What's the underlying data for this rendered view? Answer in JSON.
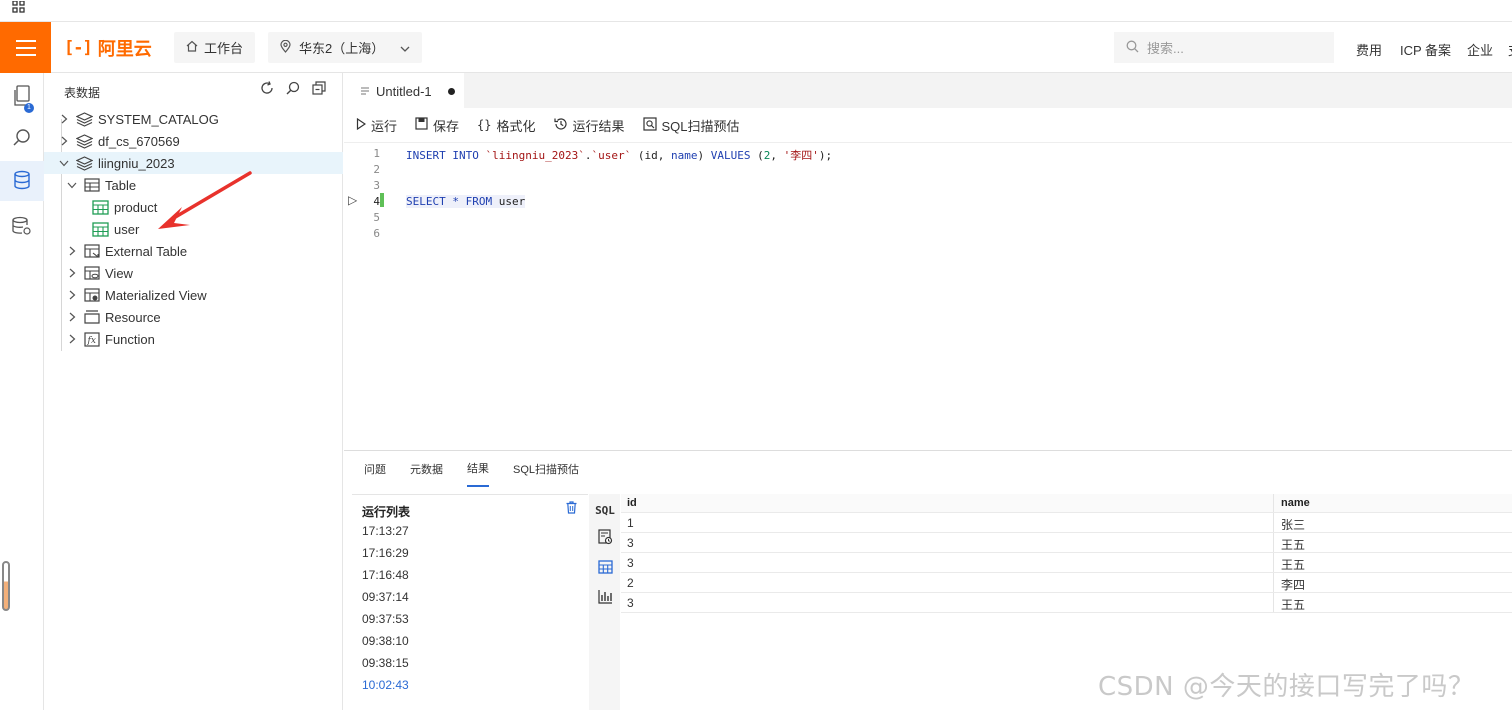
{
  "header": {
    "logo_text": "阿里云",
    "workbench_label": "工作台",
    "region_label": "华东2（上海）",
    "search_placeholder": "搜索...",
    "links": [
      "费用",
      "ICP 备案",
      "企业",
      "支"
    ]
  },
  "rail": {
    "badge": "1"
  },
  "tree": {
    "title": "表数据",
    "nodes": [
      {
        "label": "SYSTEM_CATALOG"
      },
      {
        "label": "df_cs_670569"
      },
      {
        "label": "liingniu_2023"
      },
      {
        "label": "Table"
      },
      {
        "label": "product"
      },
      {
        "label": "user"
      },
      {
        "label": "External Table"
      },
      {
        "label": "View"
      },
      {
        "label": "Materialized View"
      },
      {
        "label": "Resource"
      },
      {
        "label": "Function"
      }
    ]
  },
  "editor": {
    "tab_label": "Untitled-1",
    "toolbar": [
      "运行",
      "保存",
      "格式化",
      "运行结果",
      "SQL扫描预估"
    ],
    "line_numbers": [
      "1",
      "2",
      "3",
      "4",
      "5",
      "6"
    ],
    "line1": {
      "insert": "INSERT INTO",
      "db": "`liingniu_2023`",
      "dot": ".",
      "table": "`user`",
      "cols_open": " (id, ",
      "name_kw": "name",
      "cols_close": ") ",
      "values": "VALUES",
      "vals_open": " (",
      "num": "2",
      "comma": ", ",
      "str": "'李四'",
      "end": ");"
    },
    "line4": {
      "select": "SELECT",
      "star": " * ",
      "from": "FROM",
      "table": " user"
    }
  },
  "bottom": {
    "tabs": [
      "问题",
      "元数据",
      "结果",
      "SQL扫描预估"
    ],
    "active_tab": "结果",
    "runlist_title": "运行列表",
    "run_times": [
      "17:13:27",
      "17:16:29",
      "17:16:48",
      "09:37:14",
      "09:37:53",
      "09:38:10",
      "09:38:15",
      "10:02:43"
    ],
    "sql_icon_label": "SQL",
    "columns": [
      "id",
      "name"
    ],
    "rows": [
      [
        "1",
        "张三"
      ],
      [
        "3",
        "王五"
      ],
      [
        "3",
        "王五"
      ],
      [
        "2",
        "李四"
      ],
      [
        "3",
        "王五"
      ]
    ]
  },
  "watermark": "CSDN @今天的接口写完了吗？",
  "colors": {
    "accent": "#ff6a00",
    "link": "#2a6ad4",
    "annotation_arrow": "#e8322c"
  }
}
